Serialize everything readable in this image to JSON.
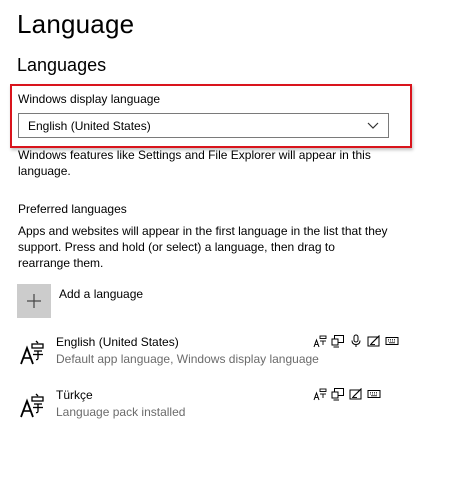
{
  "page": {
    "title": "Language",
    "section_title": "Languages"
  },
  "display_language": {
    "label": "Windows display language",
    "selected": "English (United States)",
    "description": "Windows features like Settings and File Explorer will appear in this language."
  },
  "preferred": {
    "title": "Preferred languages",
    "description": "Apps and websites will appear in the first language in the list that they support. Press and hold (or select) a language, then drag to rearrange them.",
    "add_label": "Add a language",
    "languages": [
      {
        "name": "English (United States)",
        "status": "Default app language, Windows display language",
        "features": [
          "language-pack-icon",
          "text-to-speech-icon",
          "speech-recognition-icon",
          "handwriting-icon",
          "keyboard-icon"
        ]
      },
      {
        "name": "Türkçe",
        "status": "Language pack installed",
        "features": [
          "language-pack-icon",
          "text-to-speech-icon",
          "handwriting-icon",
          "keyboard-icon"
        ]
      }
    ]
  },
  "colors": {
    "highlight": "#d9141c",
    "add_tile": "#cccccc",
    "secondary_text": "#6b6b6b"
  }
}
